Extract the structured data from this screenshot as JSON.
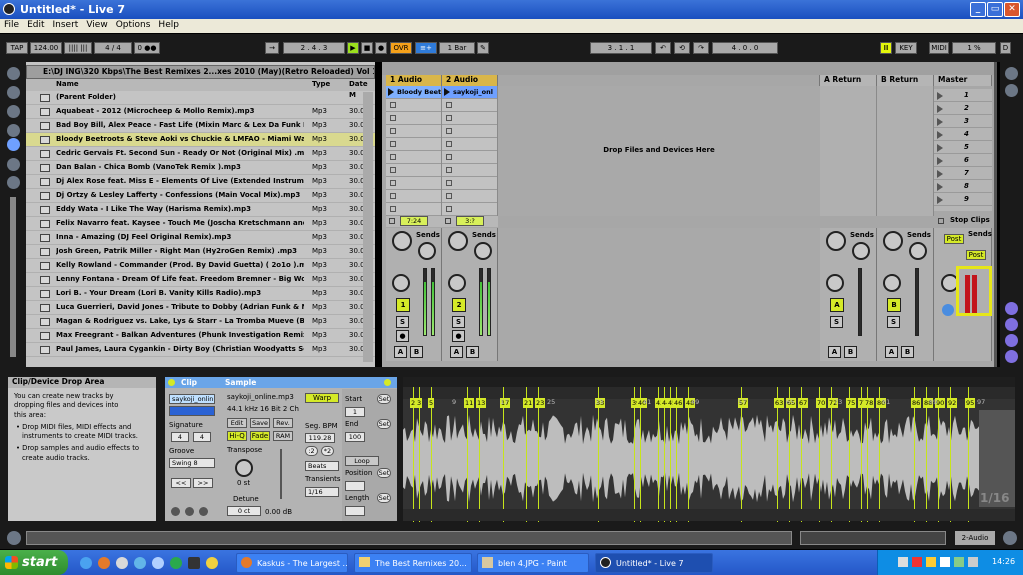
{
  "window": {
    "title": "Untitled* - Live 7",
    "min": "_",
    "max": "▭",
    "close": "✕"
  },
  "menu": [
    "File",
    "Edit",
    "Insert",
    "View",
    "Options",
    "Help"
  ],
  "transport": {
    "tap": "TAP",
    "tempo": "124.00",
    "nudge": "|||| |||",
    "signature": "4 / 4",
    "metro": "0 ●●",
    "arrow": "→",
    "position": "2 . 4 . 3",
    "ovr": "OVR",
    "quant": "1 Bar",
    "loop_start": "3 . 1 . 1",
    "loop_len": "4 . 0 . 0",
    "key": "KEY",
    "midi": "MIDI",
    "cpu": "1 %",
    "d": "D"
  },
  "browser": {
    "path": "E:\\DJ ING\\320 Kbps\\The Best Remixes 2...xes 2010 (May)(Retro Reloaded) Vol 1\\",
    "col_name": "Name",
    "col_type": "Type",
    "col_date": "Date M",
    "rows": [
      {
        "name": "(Parent Folder)",
        "type": "",
        "date": ""
      },
      {
        "name": "Aquabeat - 2012 (Microcheep & Mollo Remix).mp3",
        "type": "Mp3",
        "date": "30.04."
      },
      {
        "name": "Bad Boy Bill, Alex Peace - Fast Life (Mixin Marc & Lex Da Funk Remix) .mp3",
        "type": "Mp3",
        "date": "30.04."
      },
      {
        "name": "Bloody Beetroots & Steve Aoki vs Chuckie & LMFAO - Miami Warp (So...",
        "type": "Mp3",
        "date": "30.04."
      },
      {
        "name": "Cedric Gervais Ft. Second Sun - Ready Or Not (Original Mix) .mp3",
        "type": "Mp3",
        "date": "30.04."
      },
      {
        "name": "Dan Balan - Chica Bomb (VanoTek Remix ).mp3",
        "type": "Mp3",
        "date": "30.04."
      },
      {
        "name": "Dj Alex Rose feat. Miss E - Elements Of Live  (Extended Instrumental M...",
        "type": "Mp3",
        "date": "30.04."
      },
      {
        "name": "Dj Ortzy & Lesley Lafferty - Confessions (Main Vocal Mix).mp3",
        "type": "Mp3",
        "date": "30.04."
      },
      {
        "name": "Eddy Wata - I Like The Way (Harisma Remix).mp3",
        "type": "Mp3",
        "date": "30.04."
      },
      {
        "name": "Felix Navarro feat. Kaysee - Touch Me (Joscha Kretschmann and Eesy ...",
        "type": "Mp3",
        "date": "30.04."
      },
      {
        "name": "Inna - Amazing (DJ Feel Original Remix).mp3",
        "type": "Mp3",
        "date": "30.04."
      },
      {
        "name": "Josh Green, Patrik Miller - Right Man (Hy2roGen Remix) .mp3",
        "type": "Mp3",
        "date": "30.04."
      },
      {
        "name": "Kelly Rowland - Commander (Prod. By David Guetta) ( 2o1o ).mp3",
        "type": "Mp3",
        "date": "30.04."
      },
      {
        "name": "Lenny Fontana - Dream Of Life feat. Freedom Bremner - Big World & D...",
        "type": "Mp3",
        "date": "30.04."
      },
      {
        "name": "Lori B. - Your Dream (Lori B. Vanity Kills Radio).mp3",
        "type": "Mp3",
        "date": "30.04."
      },
      {
        "name": "Luca Guerrieri, David Jones - Tribute to Dobby (Adrian Funk & Niro Las...",
        "type": "Mp3",
        "date": "30.04."
      },
      {
        "name": "Magan & Rodriguez vs. Lake, Lys & Starr - La Tromba Mueve (Brun & F...",
        "type": "Mp3",
        "date": "30.04."
      },
      {
        "name": "Max Freegrant - Balkan Adventures (Phunk Investigation Remix) .mp3",
        "type": "Mp3",
        "date": "30.04."
      },
      {
        "name": "Paul James, Laura Cygankin - Dirty Boy (Christian Woodyatts Sensoul V...",
        "type": "Mp3",
        "date": "30.04."
      }
    ]
  },
  "session": {
    "tracks": [
      {
        "name": "1 Audio",
        "clip": "Bloody Beet",
        "time": "7:24",
        "num": "1"
      },
      {
        "name": "2 Audio",
        "clip": "saykoji_onl",
        "time": "3:?",
        "num": "2"
      }
    ],
    "returns": [
      {
        "name": "A Return",
        "letter": "A"
      },
      {
        "name": "B Return",
        "letter": "B"
      }
    ],
    "master": "Master",
    "drop_text": "Drop Files and Devices Here",
    "scenes": [
      "1",
      "2",
      "3",
      "4",
      "5",
      "6",
      "7",
      "8",
      "9"
    ],
    "stop_clips": "Stop Clips",
    "sends": "Sends",
    "post": "Post",
    "s": "S",
    "a": "A",
    "b": "B"
  },
  "info": {
    "title": "Clip/Device Drop Area",
    "lines": [
      "You can create new tracks by",
      "dropping files and devices into",
      "this area:"
    ],
    "bullets": [
      "Drop MIDI files, MIDI effects and instruments to create MIDI tracks.",
      "Drop samples and audio effects to create audio tracks."
    ]
  },
  "clip": {
    "header": "Clip",
    "name": "saykoji_onlin",
    "signature_label": "Signature",
    "sig_num": "4",
    "sig_den": "4",
    "groove_label": "Groove",
    "groove": "Swing 8",
    "left": "<<",
    "right": ">>"
  },
  "sample": {
    "header": "Sample",
    "file": "saykoji_online.mp3",
    "format": "44.1 kHz 16 Bit 2 Ch",
    "warp": "Warp",
    "edit": "Edit",
    "save": "Save",
    "rev": "Rev.",
    "hiq": "Hi-Q",
    "fade": "Fade",
    "ram": "RAM",
    "seg_bpm_label": "Seg. BPM",
    "seg_bpm": "119.28",
    "half": ":2",
    "dbl": "*2",
    "transpose_label": "Transpose",
    "transpose": "0 st",
    "detune_label": "Detune",
    "detune": "0 ct",
    "gain": "0.00 dB",
    "beats": "Beats",
    "transients_label": "Transients",
    "transients": "1/16",
    "start_label": "Start",
    "start": "1",
    "end_label": "End",
    "end": "100",
    "loop": "Loop",
    "position_label": "Position",
    "length_label": "Length",
    "set": "Set"
  },
  "waveform": {
    "markers": [
      "2",
      "3",
      "5",
      "11",
      "13",
      "17",
      "21",
      "23",
      "33",
      "39",
      "40",
      "43",
      "44",
      "45",
      "46",
      "48",
      "57",
      "63",
      "65",
      "67",
      "70",
      "72",
      "75",
      "77",
      "78",
      "80",
      "86",
      "88",
      "90",
      "92",
      "95"
    ],
    "bar_labels": [
      "9",
      "17",
      "25",
      "33",
      "41",
      "49",
      "57",
      "65",
      "73",
      "81",
      "89",
      "97"
    ],
    "time_labels": [
      "0:00",
      "0:30",
      "1:00",
      "1:30",
      "2:00",
      "2:30",
      "3:00"
    ],
    "zoom": "1/16"
  },
  "status": {
    "track": "2-Audio"
  },
  "taskbar": {
    "start": "start",
    "tasks": [
      "Kaskus - The Largest ...",
      "The Best Remixes 20...",
      "blen 4.JPG - Paint",
      "Untitled* - Live 7"
    ],
    "lang": "EN",
    "clock": "14:26"
  }
}
